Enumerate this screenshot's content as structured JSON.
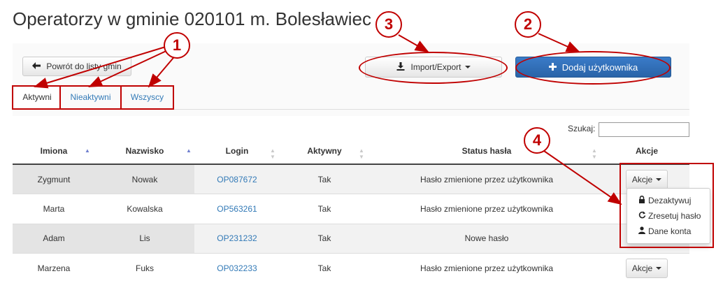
{
  "page": {
    "title": "Operatorzy w gminie 020101 m. Bolesławiec"
  },
  "toolbar": {
    "back_label": "Powrót do listy gmin",
    "back_icon": "arrow-left-icon",
    "import_export_label": "Import/Export",
    "import_export_icon": "download-icon",
    "add_user_label": "Dodaj użytkownika",
    "add_user_icon": "plus-icon"
  },
  "tabs": [
    {
      "label": "Aktywni",
      "active": true
    },
    {
      "label": "Nieaktywni",
      "active": false
    },
    {
      "label": "Wszyscy",
      "active": false
    }
  ],
  "search": {
    "label": "Szukaj:",
    "value": ""
  },
  "table": {
    "headers": [
      "Imiona",
      "Nazwisko",
      "Login",
      "Aktywny",
      "Status hasła",
      "Akcje"
    ],
    "rows": [
      {
        "first_name": "Zygmunt",
        "last_name": "Nowak",
        "login": "OP087672",
        "active": "Tak",
        "password_status": "Hasło zmienione przez użytkownika",
        "action": "Akcje"
      },
      {
        "first_name": "Marta",
        "last_name": "Kowalska",
        "login": "OP563261",
        "active": "Tak",
        "password_status": "Hasło zmienione przez użytkownika",
        "action": ""
      },
      {
        "first_name": "Adam",
        "last_name": "Lis",
        "login": "OP231232",
        "active": "Tak",
        "password_status": "Nowe hasło",
        "action": ""
      },
      {
        "first_name": "Marzena",
        "last_name": "Fuks",
        "login": "OP032233",
        "active": "Tak",
        "password_status": "Hasło zmienione przez użytkownika",
        "action": "Akcje"
      }
    ]
  },
  "actions_menu": {
    "items": [
      {
        "label": "Dezaktywuj",
        "icon": "lock-icon"
      },
      {
        "label": "Zresetuj hasło",
        "icon": "refresh-icon"
      },
      {
        "label": "Dane konta",
        "icon": "user-icon"
      }
    ]
  },
  "annotations": {
    "callout_1": "1",
    "callout_2": "2",
    "callout_3": "3",
    "callout_4": "4"
  },
  "colors": {
    "accent": "#337ab7",
    "primary_button": "#2f6db5",
    "annotation": "#c00000"
  }
}
